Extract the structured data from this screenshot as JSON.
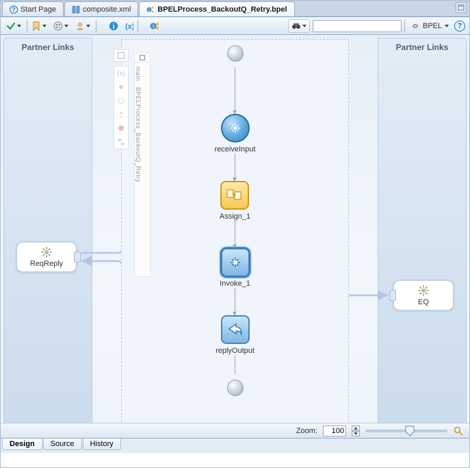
{
  "tabs": {
    "start": "Start Page",
    "composite": "composite.xml",
    "bpel": "BPELProcess_BackoutQ_Retry.bpel"
  },
  "toolbar": {
    "lang_label": "BPEL",
    "search_placeholder": ""
  },
  "panels": {
    "left_title": "Partner Links",
    "right_title": "Partner Links"
  },
  "swimlane": {
    "header": "main",
    "label": "BPELProcess_BackoutQ_Retry"
  },
  "activities": {
    "receive": "receiveInput",
    "assign": "Assign_1",
    "invoke": "Invoke_1",
    "reply": "replyOutput"
  },
  "partnerlinks": {
    "left": "ReqReply",
    "right": "EQ"
  },
  "zoom": {
    "label": "Zoom:",
    "value": "100"
  },
  "bottom_tabs": {
    "design": "Design",
    "source": "Source",
    "history": "History"
  }
}
